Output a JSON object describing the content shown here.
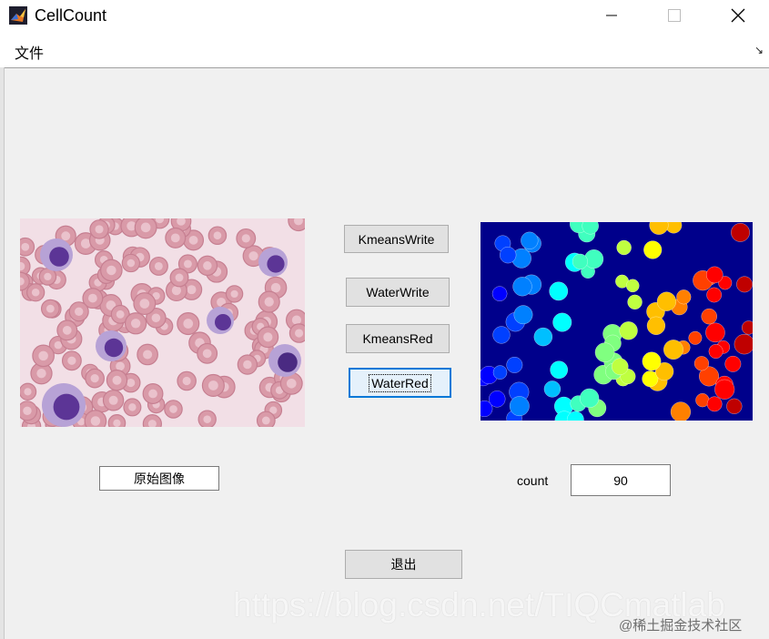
{
  "window": {
    "title": "CellCount"
  },
  "menu": {
    "file_label": "文件"
  },
  "buttons": {
    "kmeans_write": "KmeansWrite",
    "water_write": "WaterWrite",
    "kmeans_red": "KmeansRed",
    "water_red": "WaterRed",
    "exit": "退出"
  },
  "original_label": "原始图像",
  "count": {
    "label": "count",
    "value": "90"
  },
  "watermark": {
    "url": "https://blog.csdn.net/TIQCmatlab",
    "community": "@稀土掘金技术社区"
  },
  "colors": {
    "segmented_background": "#00008b",
    "blood_background": "#f2dfe6"
  }
}
